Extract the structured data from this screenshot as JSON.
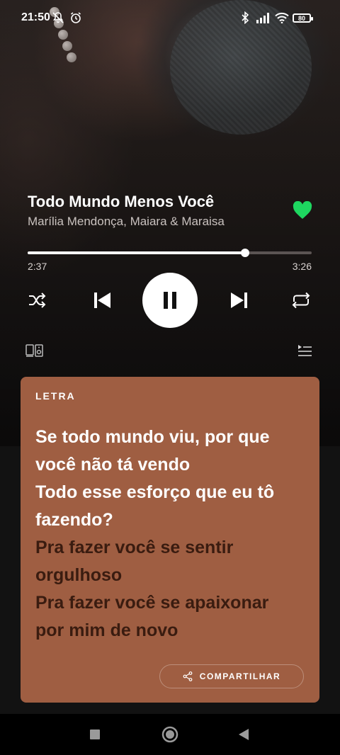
{
  "status_bar": {
    "time": "21:50",
    "battery": "80",
    "icons": [
      "notifications-muted-icon",
      "alarm-icon",
      "bluetooth-icon",
      "signal-icon",
      "wifi-icon",
      "battery-icon"
    ]
  },
  "track": {
    "title": "Todo Mundo Menos Você",
    "artist": "Marília Mendonça, Maiara & Maraisa",
    "liked": true
  },
  "playback": {
    "elapsed": "2:37",
    "total": "3:26",
    "progress_fraction": 0.765,
    "is_playing": true
  },
  "lyrics": {
    "label": "LETRA",
    "lines": [
      {
        "text": "Se todo mundo viu, por que",
        "active": true
      },
      {
        "text": "você não tá vendo",
        "active": true
      },
      {
        "text": "Todo esse esforço que eu tô",
        "active": true
      },
      {
        "text": "fazendo?",
        "active": true
      },
      {
        "text": "Pra fazer você se sentir",
        "active": false
      },
      {
        "text": "orgulhoso",
        "active": false
      },
      {
        "text": "Pra fazer você se apaixonar",
        "active": false
      },
      {
        "text": "por mim de novo",
        "active": false
      }
    ],
    "share_label": "COMPARTILHAR"
  },
  "colors": {
    "accent_green": "#1ed760",
    "lyrics_card": "#9f5e42",
    "lyric_dim": "#3a1c10"
  }
}
